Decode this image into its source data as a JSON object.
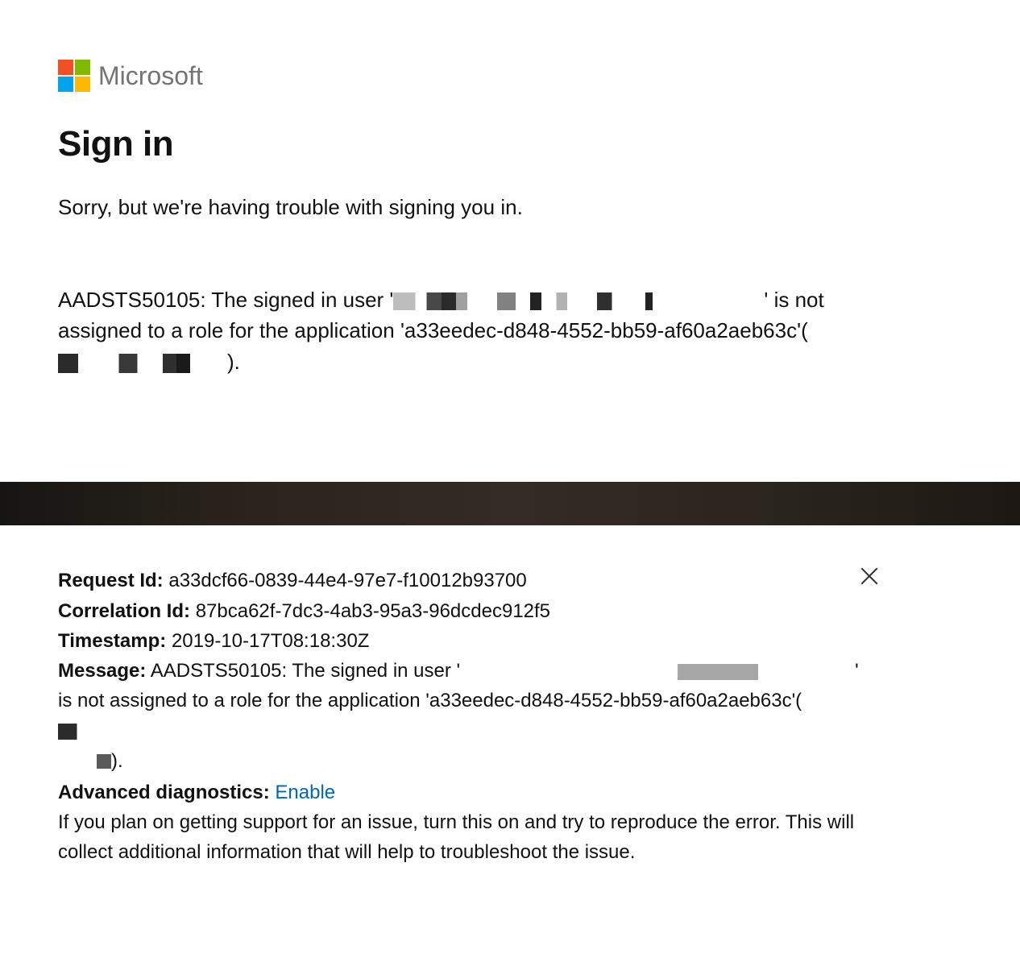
{
  "brand": {
    "name": "Microsoft"
  },
  "header": {
    "title": "Sign in",
    "subtitle": "Sorry, but we're having trouble with signing you in."
  },
  "error": {
    "prefix": "AADSTS50105: The signed in user '",
    "mid1": "' is not assigned to a role for the application '",
    "app_id": "a33eedec-d848-4552-bb59-af60a2aeb63c",
    "mid2": "'(",
    "suffix": ")."
  },
  "details": {
    "request_id_label": "Request Id:",
    "request_id": "a33dcf66-0839-44e4-97e7-f10012b93700",
    "correlation_id_label": "Correlation Id:",
    "correlation_id": "87bca62f-7dc3-4ab3-95a3-96dcdec912f5",
    "timestamp_label": "Timestamp:",
    "timestamp": "2019-10-17T08:18:30Z",
    "message_label": "Message:",
    "message_prefix": "AADSTS50105: The signed in user '",
    "message_mid1": "' is not assigned to a role for the application '",
    "message_app_id": "a33eedec-d848-4552-bb59-af60a2aeb63c",
    "message_mid2": "'(",
    "message_suffix": ")."
  },
  "diagnostics": {
    "label": "Advanced diagnostics:",
    "link": "Enable",
    "help": "If you plan on getting support for an issue, turn this on and try to reproduce the error. This will collect additional information that will help to troubleshoot the issue."
  }
}
